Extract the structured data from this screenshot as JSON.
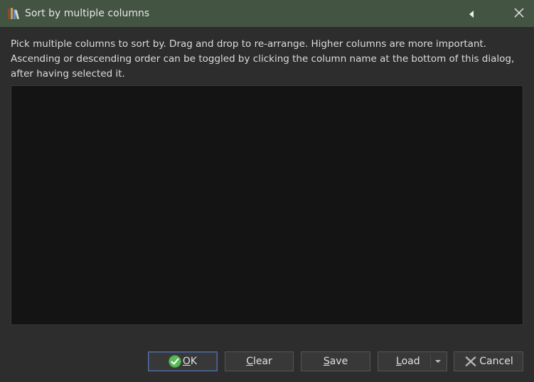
{
  "window": {
    "title": "Sort by multiple columns"
  },
  "titlebar": {
    "app_icon": "books-icon",
    "collapse_icon": "triangle-left-icon",
    "close_icon": "close-icon"
  },
  "description": {
    "line1": "Pick multiple columns to sort by. Drag and drop to re-arrange. Higher columns are more important.",
    "line2": "Ascending or descending order can be toggled by clicking the column name at the bottom of this dialog,",
    "line3": "after having selected it."
  },
  "sort_list": {
    "items": []
  },
  "buttons": {
    "ok": {
      "mnemonic": "O",
      "rest": "K",
      "icon": "check-circle-icon"
    },
    "clear": {
      "mnemonic": "C",
      "rest": "lear"
    },
    "save": {
      "mnemonic": "S",
      "rest": "ave"
    },
    "load": {
      "mnemonic": "L",
      "rest": "oad",
      "icon": "chevron-down-icon"
    },
    "cancel": {
      "label": "Cancel",
      "icon": "x-icon"
    }
  },
  "colors": {
    "titlebar": "#435443",
    "background": "#2d2d2d",
    "list_background": "#141414",
    "ok_check": "#5cb85c"
  }
}
